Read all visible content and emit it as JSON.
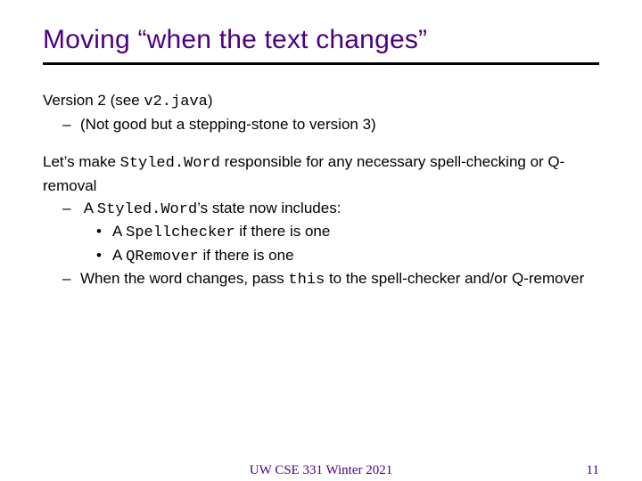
{
  "title": "Moving “when the text changes”",
  "line1_a": "Version 2 (see ",
  "line1_code": "v2.java",
  "line1_b": ")",
  "bullet1": "(Not good but a stepping-stone to version 3)",
  "line2_a": "Let’s make ",
  "line2_code": "Styled.Word",
  "line2_b": " responsible for any necessary spell-checking or Q-removal",
  "bullet2_a": "A ",
  "bullet2_code": "Styled.Word",
  "bullet2_b": "’s state now includes:",
  "sub1_a": "A ",
  "sub1_code": "Spellchecker",
  "sub1_b": " if there is one",
  "sub2_a": "A ",
  "sub2_code": "QRemover",
  "sub2_b": " if there is one",
  "bullet3_a": "When the word changes, pass ",
  "bullet3_code": "this",
  "bullet3_b": " to the spell-checker and/or Q-remover",
  "footer_center": "UW CSE 331 Winter 2021",
  "footer_right": "11"
}
